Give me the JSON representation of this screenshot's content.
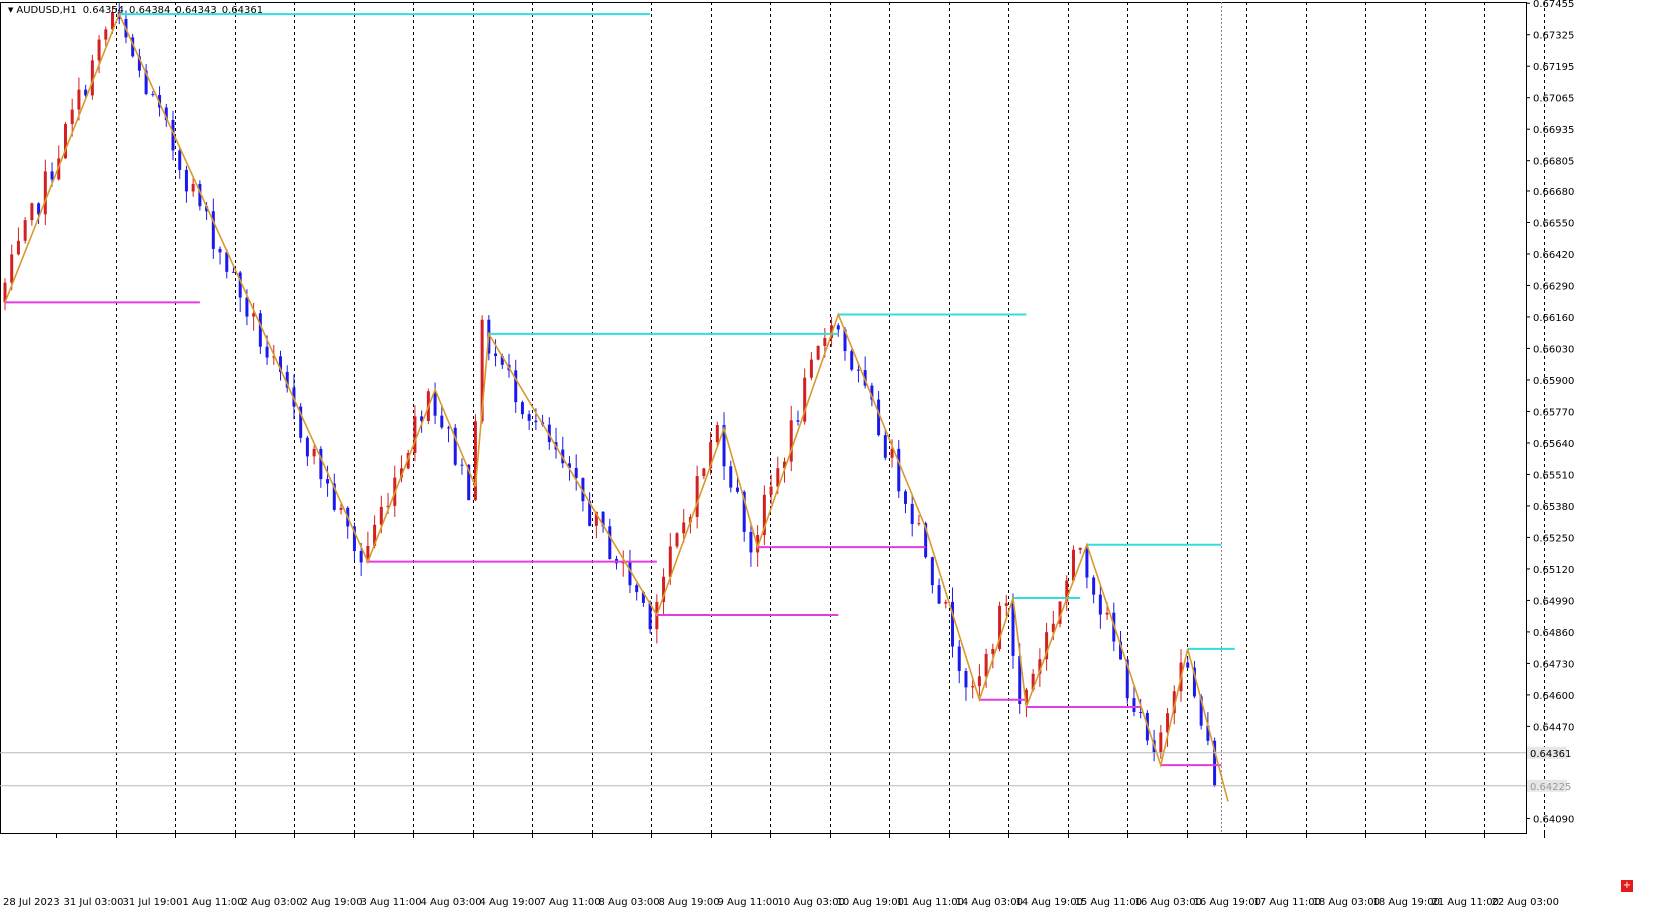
{
  "window": {
    "symbol": "AUDUSD,H1",
    "ohlc": [
      "0.64354",
      "0.64384",
      "0.64343",
      "0.64361"
    ]
  },
  "trade_button": {
    "label": "+"
  },
  "colors": {
    "background": "#ffffff",
    "bull_candle": "#d42020",
    "bear_candle": "#1a1aee",
    "zigzag": "#d99a2b",
    "resistance": "#33dddd",
    "support": "#e23ce2",
    "grid": "#000000",
    "axis": "#000000",
    "price_tag_bg": "#e6e6e6",
    "price_tag_text": "#000000"
  },
  "chart_data": {
    "type": "candlestick",
    "timeframe": "H1",
    "ylim": [
      0.6403,
      0.6746
    ],
    "y_ticks": [
      "0.67455",
      "0.67325",
      "0.67195",
      "0.67065",
      "0.66935",
      "0.66805",
      "0.66680",
      "0.66550",
      "0.66420",
      "0.66290",
      "0.66160",
      "0.66030",
      "0.65900",
      "0.65770",
      "0.65640",
      "0.65510",
      "0.65380",
      "0.65250",
      "0.65120",
      "0.64990",
      "0.64860",
      "0.64730",
      "0.64600",
      "0.64470",
      "0.64090"
    ],
    "x_ticks": [
      "28 Jul 2023",
      "31 Jul 03:00",
      "31 Jul 19:00",
      "1 Aug 11:00",
      "2 Aug 03:00",
      "2 Aug 19:00",
      "3 Aug 11:00",
      "4 Aug 03:00",
      "4 Aug 19:00",
      "7 Aug 11:00",
      "8 Aug 03:00",
      "8 Aug 19:00",
      "9 Aug 11:00",
      "10 Aug 03:00",
      "10 Aug 19:00",
      "11 Aug 11:00",
      "14 Aug 03:00",
      "14 Aug 19:00",
      "15 Aug 11:00",
      "16 Aug 03:00",
      "16 Aug 19:00",
      "17 Aug 11:00",
      "18 Aug 03:00",
      "18 Aug 19:00",
      "21 Aug 11:00",
      "22 Aug 03:00"
    ],
    "last_bar_index": 180,
    "current_price": {
      "label": "0.64361",
      "value": 0.64361
    },
    "secondary_price": {
      "label": "0.64225",
      "value": 0.64225
    },
    "zigzag": [
      {
        "bar": 0,
        "price": 0.6622
      },
      {
        "bar": 17,
        "price": 0.6741
      },
      {
        "bar": 54,
        "price": 0.6515
      },
      {
        "bar": 64,
        "price": 0.6586
      },
      {
        "bar": 70,
        "price": 0.6546
      },
      {
        "bar": 72,
        "price": 0.6609
      },
      {
        "bar": 97,
        "price": 0.6493
      },
      {
        "bar": 107,
        "price": 0.657
      },
      {
        "bar": 112,
        "price": 0.6521
      },
      {
        "bar": 124,
        "price": 0.6617
      },
      {
        "bar": 137,
        "price": 0.6529
      },
      {
        "bar": 145,
        "price": 0.6458
      },
      {
        "bar": 150,
        "price": 0.65
      },
      {
        "bar": 152,
        "price": 0.6455
      },
      {
        "bar": 161,
        "price": 0.6522
      },
      {
        "bar": 172,
        "price": 0.6431
      },
      {
        "bar": 176,
        "price": 0.6479
      },
      {
        "bar": 182,
        "price": 0.6416
      }
    ],
    "resistance_lines": [
      {
        "from_bar": 17,
        "to_bar": 96,
        "price": 0.6741
      },
      {
        "from_bar": 72,
        "to_bar": 124,
        "price": 0.6609
      },
      {
        "from_bar": 124,
        "to_bar": 152,
        "price": 0.6617
      },
      {
        "from_bar": 150,
        "to_bar": 160,
        "price": 0.65
      },
      {
        "from_bar": 161,
        "to_bar": 181,
        "price": 0.6522
      },
      {
        "from_bar": 176,
        "to_bar": 183,
        "price": 0.6479
      }
    ],
    "support_lines": [
      {
        "from_bar": 0,
        "to_bar": 29,
        "price": 0.6622
      },
      {
        "from_bar": 54,
        "to_bar": 97,
        "price": 0.6515
      },
      {
        "from_bar": 97,
        "to_bar": 124,
        "price": 0.6493
      },
      {
        "from_bar": 112,
        "to_bar": 137,
        "price": 0.6521
      },
      {
        "from_bar": 145,
        "to_bar": 152,
        "price": 0.6458
      },
      {
        "from_bar": 152,
        "to_bar": 169,
        "price": 0.6455
      },
      {
        "from_bar": 172,
        "to_bar": 181,
        "price": 0.6431
      }
    ]
  }
}
